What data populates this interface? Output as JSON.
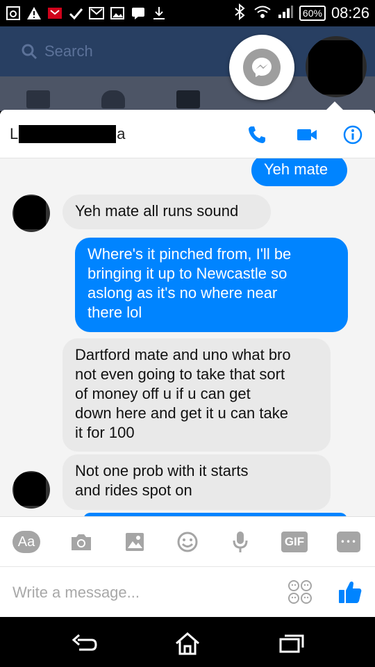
{
  "status_bar": {
    "battery": "60%",
    "time": "08:26",
    "icons": [
      "photo-icon",
      "warning-icon",
      "notification-icon",
      "check-icon",
      "gmail-icon",
      "gallery-icon",
      "message-icon",
      "download-icon",
      "bluetooth-icon",
      "wifi-icon",
      "signal-icon"
    ]
  },
  "facebook": {
    "search_placeholder": "Search"
  },
  "conversation": {
    "title_visible_start": "L",
    "title_visible_end": "a",
    "actions": [
      "phone-icon",
      "video-camera-icon",
      "info-icon"
    ]
  },
  "messages": [
    {
      "direction": "outgoing",
      "text": "Yeh mate"
    },
    {
      "direction": "incoming",
      "text": "Yeh mate all runs sound"
    },
    {
      "direction": "outgoing",
      "lines": [
        "Where's it pinched from, I'll be",
        "bringing it up to Newcastle so",
        "aslong as it's no where near",
        "there lol"
      ]
    },
    {
      "direction": "incoming",
      "lines": [
        "Dartford mate and uno what bro",
        "not even going to take that sort",
        "of money off u if u can get",
        "down here and get it u can take",
        "it for 100"
      ]
    },
    {
      "direction": "incoming",
      "lines": [
        "Not one prob with it starts",
        "and rides spot on"
      ]
    }
  ],
  "toolbar": {
    "text_button": "Aa",
    "gif_button": "GIF",
    "more_button": "•••"
  },
  "composer": {
    "placeholder": "Write a message..."
  },
  "colors": {
    "messenger_blue": "#0084ff",
    "incoming_bubble": "#e9e9e9",
    "facebook_bar": "#283f62"
  }
}
